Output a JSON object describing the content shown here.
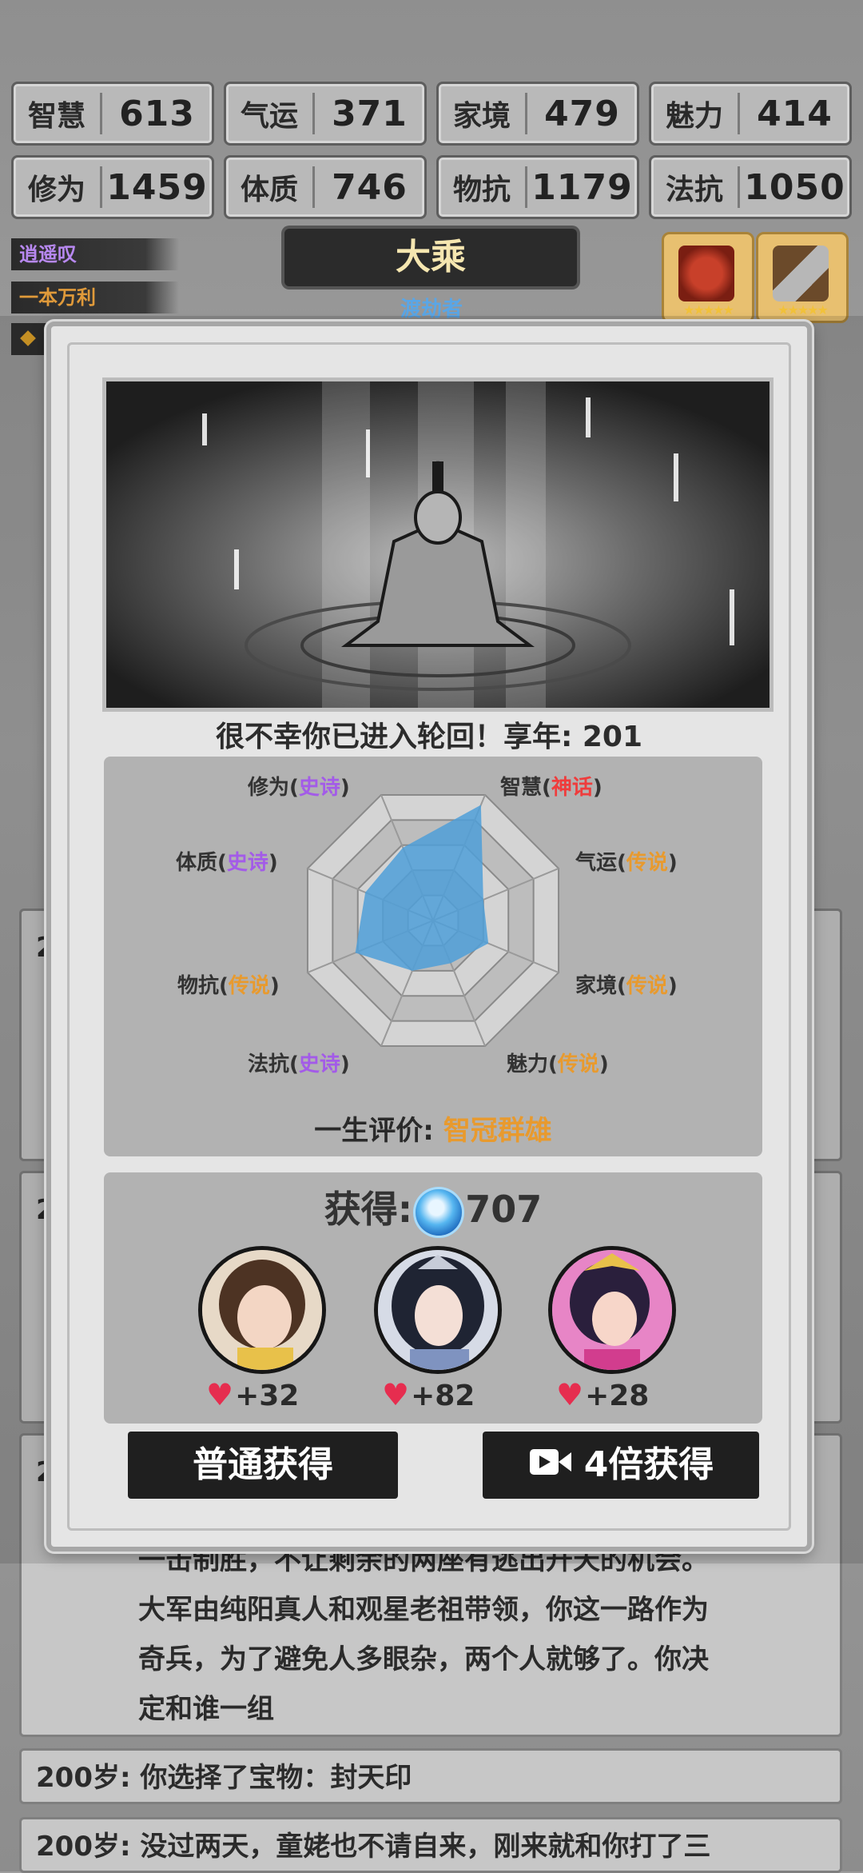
{
  "stats_row1": [
    {
      "label": "智慧",
      "value": "613"
    },
    {
      "label": "气运",
      "value": "371"
    },
    {
      "label": "家境",
      "value": "479"
    },
    {
      "label": "魅力",
      "value": "414"
    }
  ],
  "stats_row2": [
    {
      "label": "修为",
      "value": "1459"
    },
    {
      "label": "体质",
      "value": "746"
    },
    {
      "label": "物抗",
      "value": "1179"
    },
    {
      "label": "法抗",
      "value": "1050"
    }
  ],
  "side_tags": [
    "逍遥叹",
    "一本万利"
  ],
  "rank": {
    "title": "大乘",
    "subtitle": "渡劫者"
  },
  "dialog": {
    "death_text": "很不幸你已进入轮回！享年: 201",
    "radar": {
      "labels": [
        {
          "name": "智慧",
          "rarity": "神话",
          "tier": "myth"
        },
        {
          "name": "气运",
          "rarity": "传说",
          "tier": "legend"
        },
        {
          "name": "家境",
          "rarity": "传说",
          "tier": "legend"
        },
        {
          "name": "魅力",
          "rarity": "传说",
          "tier": "legend"
        },
        {
          "name": "法抗",
          "rarity": "史诗",
          "tier": "epic"
        },
        {
          "name": "物抗",
          "rarity": "传说",
          "tier": "legend"
        },
        {
          "name": "体质",
          "rarity": "史诗",
          "tier": "epic"
        },
        {
          "name": "修为",
          "rarity": "史诗",
          "tier": "epic"
        }
      ],
      "values": [
        0.92,
        0.4,
        0.44,
        0.34,
        0.4,
        0.62,
        0.54,
        0.58
      ]
    },
    "eval_label": "一生评价:",
    "eval_value": "智冠群雄",
    "gain_label": "获得:",
    "gain_value": "707",
    "companions": [
      {
        "affinity": "+32"
      },
      {
        "affinity": "+82"
      },
      {
        "affinity": "+28"
      }
    ],
    "btn_normal": "普通获得",
    "btn_4x": "4倍获得"
  },
  "logs": [
    {
      "age": "2"
    },
    {
      "age": "2"
    },
    {
      "age": "2"
    }
  ],
  "story_text": [
    "一击制胜，不让剩余的两座有逃出升天的机会。",
    "大军由纯阳真人和观星老祖带领，你这一路作为",
    "奇兵，为了避免人多眼杂，两个人就够了。你决",
    "定和谁一组"
  ],
  "log_line1": "200岁: 你选择了宝物：封天印",
  "log_line2": "200岁: 没过两天，童姥也不请自来，刚来就和你打了三"
}
